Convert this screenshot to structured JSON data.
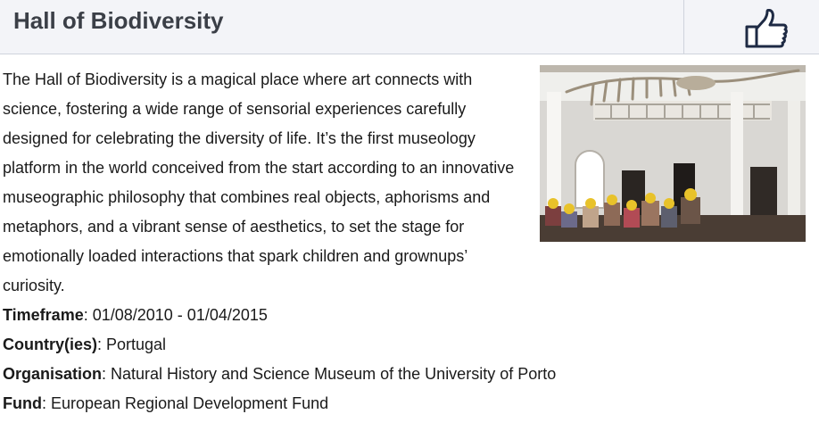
{
  "header": {
    "title": "Hall of Biodiversity",
    "like_icon": "thumbs-up-icon"
  },
  "main": {
    "description": "The Hall of Biodiversity is a magical place where art connects with science, fostering a wide range of sensorial experiences carefully designed for celebrating the diversity of life. It’s the first museology platform in the world conceived from the start according to an innovative museographic philosophy that combines real objects, aphorisms and metaphors, and a vibrant sense of aesthetics, to set the stage for emotionally loaded interactions that spark children and grownups’ curiosity.",
    "details": [
      {
        "label": "Timeframe",
        "value": ": 01/08/2010 - 01/04/2015"
      },
      {
        "label": "Country(ies)",
        "value": ": Portugal"
      },
      {
        "label": "Organisation",
        "value": ": Natural History and Science Museum of the University of Porto"
      },
      {
        "label": "Fund",
        "value": ": European Regional Development Fund"
      }
    ]
  },
  "colors": {
    "header_bg": "#f3f4f8",
    "title": "#3b3f47",
    "divider": "#cfd3dc",
    "icon_stroke": "#1e2a44",
    "cap_yellow": "#e8c22a"
  }
}
